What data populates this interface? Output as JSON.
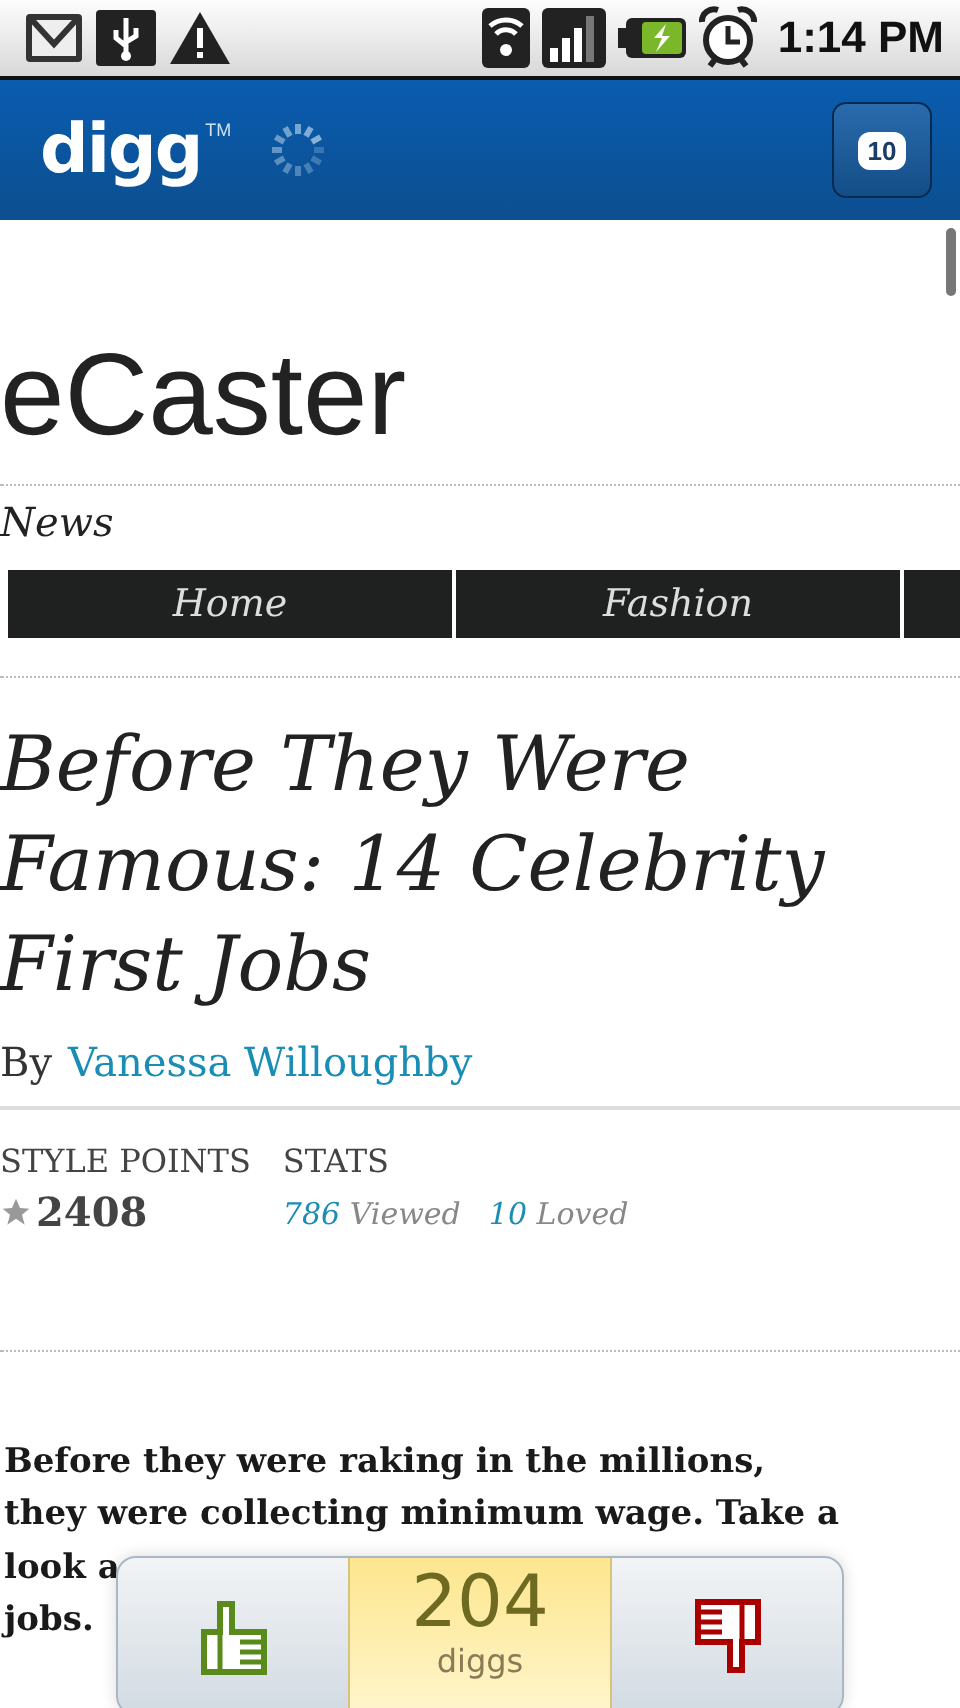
{
  "status_bar": {
    "time": "1:14 PM"
  },
  "app_bar": {
    "logo": "digg",
    "trademark": "TM",
    "loading": true,
    "comments_count": "10"
  },
  "site": {
    "logo": "eCaster",
    "section": "News",
    "nav": [
      {
        "label": "Home"
      },
      {
        "label": "Fashion"
      }
    ]
  },
  "article": {
    "title_lines": [
      "Before They Were",
      "Famous: 14 Celebrity",
      "First Jobs"
    ],
    "byline_prefix": "By",
    "author": "Vanessa Willoughby",
    "style_points_label": "STYLE POINTS",
    "style_points": "2408",
    "stats_label": "STATS",
    "stats": [
      {
        "count": "786",
        "label": "Viewed"
      },
      {
        "count": "10",
        "label": "Loved"
      }
    ],
    "body_lines": [
      "Before they were raking in the millions,",
      "they were collecting minimum wage. Take a",
      "look a",
      "jobs."
    ]
  },
  "digg_bar": {
    "count": "204",
    "unit": "diggs"
  }
}
